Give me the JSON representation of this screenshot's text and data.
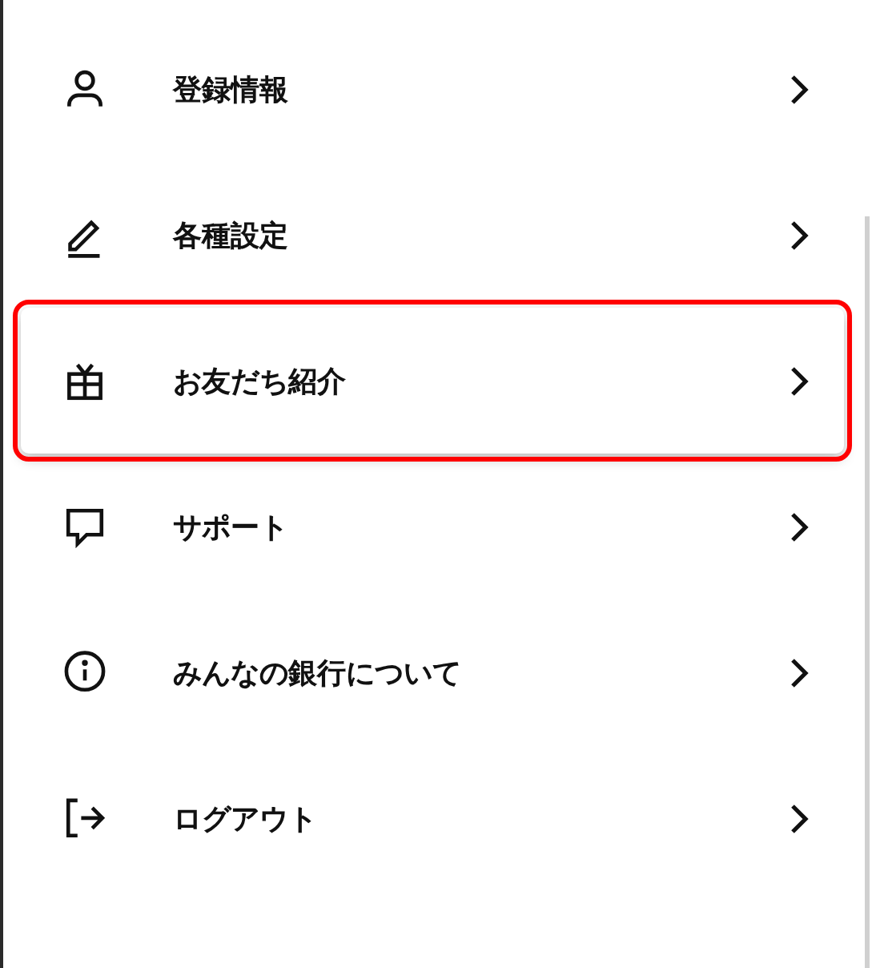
{
  "menu": {
    "items": [
      {
        "kind": "person",
        "label": "登録情報",
        "highlighted": false
      },
      {
        "kind": "pencil",
        "label": "各種設定",
        "highlighted": false
      },
      {
        "kind": "gift",
        "label": "お友だち紹介",
        "highlighted": true
      },
      {
        "kind": "speech",
        "label": "サポート",
        "highlighted": false
      },
      {
        "kind": "info",
        "label": "みんなの銀行について",
        "highlighted": false
      },
      {
        "kind": "logout",
        "label": "ログアウト",
        "highlighted": false
      }
    ]
  }
}
